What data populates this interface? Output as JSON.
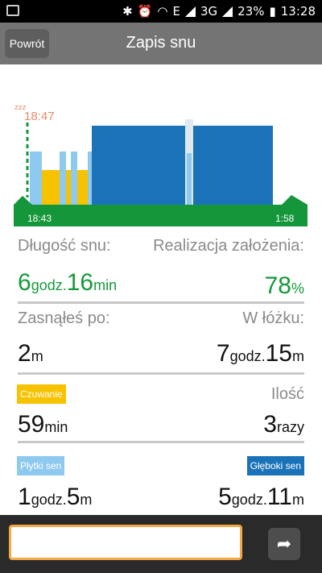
{
  "status_bar": {
    "network": "E",
    "network2": "3G",
    "battery": "23%",
    "time": "13:28"
  },
  "header": {
    "back_label": "Powrót",
    "title": "Zapis snu"
  },
  "chart": {
    "sleep_marker_time": "18:47",
    "start_time": "18:43",
    "end_time": "1:58",
    "colors": {
      "light_sleep": "#8ec9ef",
      "deep_sleep": "#1a73b8",
      "awake": "#f7c300",
      "baseline": "#15963a",
      "marker": "#e88a6a"
    }
  },
  "chart_data": {
    "type": "bar",
    "x_start": "18:43",
    "x_end": "1:58",
    "series": [
      {
        "name": "Czuwanie",
        "values": [
          1
        ]
      },
      {
        "name": "Płytki sen",
        "values": [
          1
        ]
      },
      {
        "name": "Głęboki sen",
        "values": [
          1
        ]
      }
    ]
  },
  "stats": {
    "sleep_length_label": "Długość snu:",
    "goal_label": "Realizacja założenia:",
    "sleep_hours": "6",
    "sleep_hours_unit": "godz.",
    "sleep_minutes": "16",
    "sleep_minutes_unit": "min",
    "goal_value": "78",
    "goal_unit": "%",
    "fell_asleep_label": "Zasnąłeś po:",
    "in_bed_label": "W łóżku:",
    "fell_asleep_value": "2",
    "fell_asleep_unit": "m",
    "in_bed_hours": "7",
    "in_bed_hours_unit": "godz.",
    "in_bed_minutes": "15",
    "in_bed_minutes_unit": "m",
    "awake_tag": "Czuwanie",
    "count_label": "Ilość",
    "awake_value": "59",
    "awake_unit": "min",
    "count_value": "3",
    "count_unit": "razy",
    "light_tag": "Płytki sen",
    "deep_tag": "Głęboki sen",
    "light_hours": "1",
    "light_hours_unit": "godz.",
    "light_minutes": "5",
    "light_minutes_unit": "m",
    "deep_hours": "5",
    "deep_hours_unit": "godz.",
    "deep_minutes": "11",
    "deep_minutes_unit": "m"
  },
  "bottom": {
    "note_placeholder": ""
  }
}
